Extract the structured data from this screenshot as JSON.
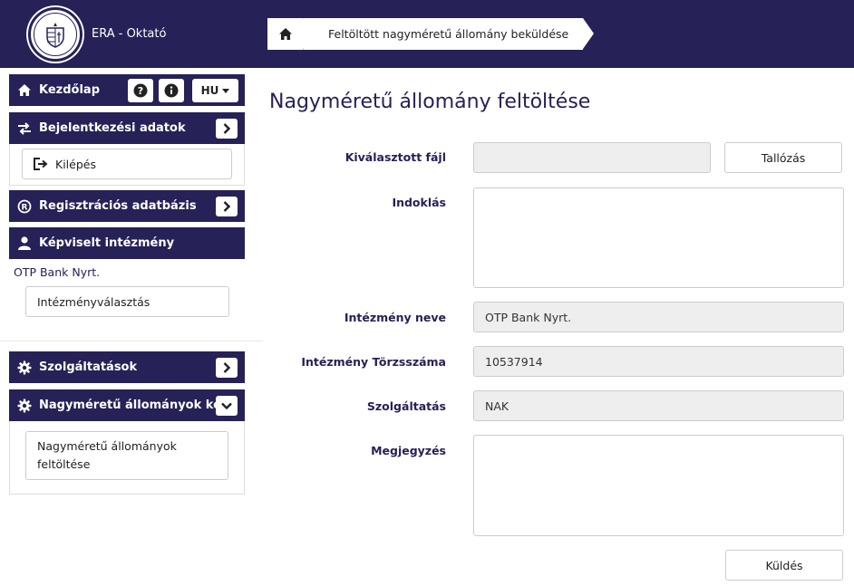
{
  "header": {
    "app_title": "ERA - Oktató",
    "logo_text": "MAGYAR NEMZETI BANK",
    "breadcrumb": {
      "home_icon": "home-icon",
      "current": "Feltöltött nagyméretű állomány beküldése"
    }
  },
  "sidebar": {
    "home": {
      "label": "Kezdőlap",
      "icon": "home-icon",
      "help_icon": "question-icon",
      "info_icon": "info-icon",
      "lang": "HU"
    },
    "login_data": {
      "label": "Bejelentkezési adatok",
      "icon": "exchange-icon",
      "logout_label": "Kilépés",
      "logout_icon": "logout-icon"
    },
    "registry": {
      "label": "Regisztrációs adatbázis",
      "icon": "registered-icon"
    },
    "represented": {
      "label": "Képviselt intézmény",
      "icon": "user-icon",
      "institution": "OTP Bank Nyrt.",
      "choose_label": "Intézményválasztás"
    },
    "services": {
      "label": "Szolgáltatások",
      "icon": "gear-icon"
    },
    "large_files": {
      "label": "Nagyméretű állományok ke...",
      "icon": "gear-icon",
      "sub_item": "Nagyméretű állományok feltöltése"
    }
  },
  "main": {
    "title": "Nagyméretű állomány feltöltése",
    "fields": {
      "file_label": "Kiválasztott fájl",
      "file_value": "",
      "browse_label": "Tallózás",
      "reason_label": "Indoklás",
      "reason_value": "",
      "inst_name_label": "Intézmény neve",
      "inst_name_value": "OTP Bank Nyrt.",
      "inst_id_label": "Intézmény Törzsszáma",
      "inst_id_value": "10537914",
      "service_label": "Szolgáltatás",
      "service_value": "NAK",
      "note_label": "Megjegyzés",
      "note_value": ""
    },
    "submit_label": "Küldés"
  },
  "colors": {
    "primary": "#262157",
    "input_bg": "#eeeeee",
    "border": "#cccccc"
  }
}
